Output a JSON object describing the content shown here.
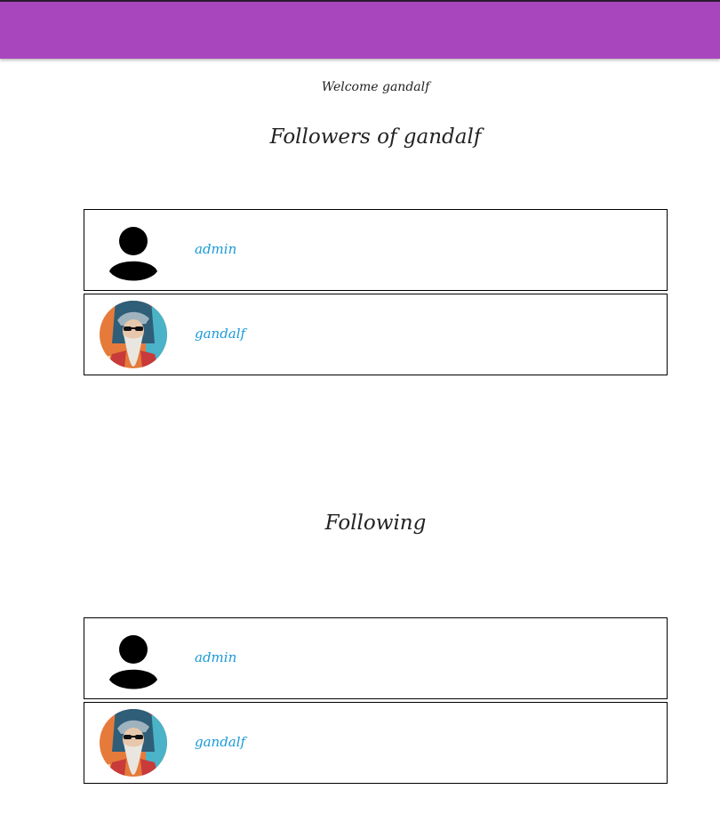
{
  "header": {
    "bar_color": "#a847bd"
  },
  "welcome_text": "Welcome gandalf",
  "followers": {
    "title": "Followers of gandalf",
    "users": [
      {
        "name": "admin",
        "avatar": "default-person-icon"
      },
      {
        "name": "gandalf",
        "avatar": "wizard-portrait"
      }
    ]
  },
  "following": {
    "title": "Following",
    "users": [
      {
        "name": "admin",
        "avatar": "default-person-icon"
      },
      {
        "name": "gandalf",
        "avatar": "wizard-portrait"
      }
    ]
  },
  "colors": {
    "link": "#1a9ad9",
    "border": "#000000"
  }
}
